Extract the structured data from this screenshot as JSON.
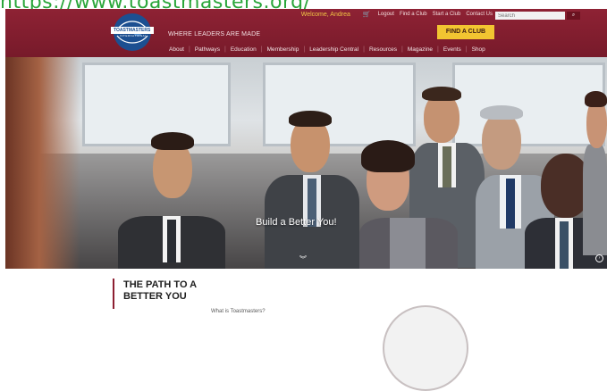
{
  "url_caption": "https://www.toastmasters.org/",
  "header": {
    "logo_text": "TOASTMASTERS",
    "logo_subtext": "INTERNATIONAL",
    "tagline": "WHERE LEADERS ARE MADE",
    "find_club_label": "FIND A CLUB",
    "welcome": "Welcome, Andrea",
    "top_links": [
      "Logout",
      "Find a Club",
      "Start a Club",
      "Contact Us"
    ],
    "search_placeholder": "Search",
    "search_icon": "search-icon",
    "cart_icon": "cart-icon",
    "nav_items": [
      "About",
      "Pathways",
      "Education",
      "Membership",
      "Leadership Central",
      "Resources",
      "Magazine",
      "Events",
      "Shop"
    ]
  },
  "hero": {
    "caption": "Build a Better You!",
    "scroll_icon": "chevron-double-down-icon",
    "corner_icon": "circle-arrow-icon"
  },
  "section": {
    "title_line1": "THE PATH TO A",
    "title_line2": "BETTER YOU",
    "question": "What is Toastmasters?"
  },
  "colors": {
    "brand": "#8e2234",
    "accent": "#f2c531",
    "caption": "#2aa63a"
  }
}
